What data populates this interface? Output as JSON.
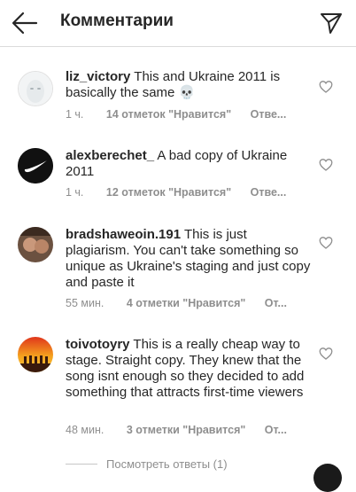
{
  "header": {
    "title": "Комментарии"
  },
  "comments": [
    {
      "username": "liz_victory",
      "text": "This and Ukraine 2011 is basically  the same 💀",
      "time": "1 ч.",
      "likes": "14 отметок \"Нравится\"",
      "reply": "Отве..."
    },
    {
      "username": "alexberechet_",
      "text": "A bad copy of Ukraine 2011",
      "time": "1 ч.",
      "likes": "12 отметок \"Нравится\"",
      "reply": "Отве..."
    },
    {
      "username": "bradshaweoin.191",
      "text": "This is just plagiarism. You can't take something so unique as Ukraine's staging and just copy and paste it",
      "time": "55 мин.",
      "likes": "4 отметки \"Нравится\"",
      "reply": "От..."
    },
    {
      "username": "toivotoyry",
      "text": "This is a really cheap way to stage. Straight copy. They knew that the song isnt enough so they decided to add something that attracts first-time viewers",
      "time": "48 мин.",
      "likes": "3 отметки \"Нравится\"",
      "reply": "От..."
    }
  ],
  "view_replies": "Посмотреть ответы (1)",
  "icons": [
    "arrow-left-icon",
    "paper-plane-icon",
    "heart-outline-icon"
  ]
}
